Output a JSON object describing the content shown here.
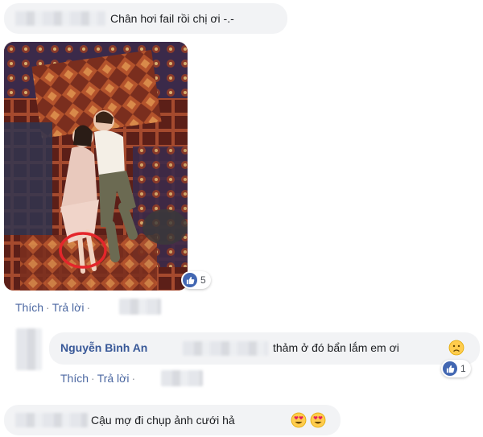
{
  "comments": [
    {
      "text": "Chân hơi fail rồi chị ơi -.-"
    },
    {
      "reaction_count": "5",
      "actions": {
        "like": "Thích",
        "reply": "Trả lời"
      }
    },
    {
      "author": "Nguyễn Bình An",
      "text": "thảm ở đó bẩn lắm em ơi",
      "reaction_count": "1",
      "actions": {
        "like": "Thích",
        "reply": "Trả lời"
      }
    },
    {
      "text": "Cậu mợ đi chụp ảnh cưới hả"
    }
  ],
  "colors": {
    "link": "#4b67a1",
    "bubble": "#f2f3f5",
    "like_blue": "#4267b2",
    "annotation_circle": "#e4262b"
  },
  "icons": [
    "like-icon",
    "slightly-frowning-emoji",
    "heart-eyes-emoji"
  ]
}
